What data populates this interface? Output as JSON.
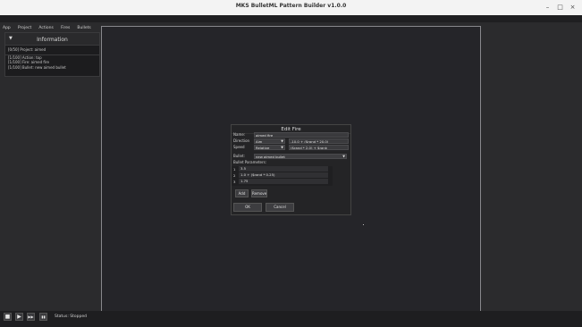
{
  "window": {
    "title": "MKS BulletML Pattern Builder v1.0.0",
    "min_icon": "–",
    "max_icon": "□",
    "close_icon": "×"
  },
  "menu": [
    "App",
    "Project",
    "Actions",
    "Fires",
    "Bullets"
  ],
  "info": {
    "title": "Information",
    "collapse_icon": "▼",
    "rows": [
      "[0/50] Project:  aimed",
      "[1/100] Action:  top",
      "[1/100] Fire:      aimed fire",
      "[1/100] Bullet:   new aimed bullet"
    ]
  },
  "dialog": {
    "title": "Edit Fire",
    "name_label": "Name:",
    "name_value": "aimed fire",
    "direction_label": "Direction",
    "direction_type": "Aim",
    "direction_value": "-10.0 + ($rand * 20.0)",
    "speed_label": "Speed",
    "speed_type": "Relative",
    "speed_value": "($rand * 2.0) + $rank",
    "bullet_label": "Bullet:",
    "bullet_value": "new aimed bullet",
    "params_label": "Bullet Parameters:",
    "params": [
      {
        "idx": "1",
        "value": "3.5"
      },
      {
        "idx": "2",
        "value": "1.0 + ($rand * 0.25)"
      },
      {
        "idx": "3",
        "value": "1.75"
      }
    ],
    "add_label": "Add",
    "remove_label": "Remove",
    "ok_label": "OK",
    "cancel_label": "Cancel"
  },
  "controls": {
    "stop_icon": "■",
    "play_icon": "▶",
    "fast_forward_icon": "▶▶",
    "step_icon": "▮▮"
  },
  "status": "Status: Stopped"
}
